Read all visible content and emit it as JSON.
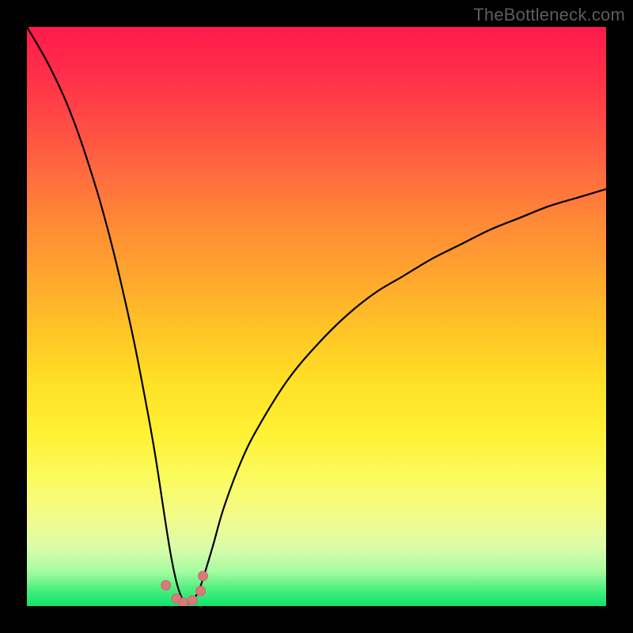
{
  "watermark": "TheBottleneck.com",
  "colors": {
    "frame_border": "#000000",
    "curve_stroke": "#000000",
    "marker_fill": "#d87a7a",
    "marker_stroke": "#c96a6a",
    "gradient_top": "#ff1a4b",
    "gradient_bottom": "#0ce36e"
  },
  "chart_data": {
    "type": "line",
    "title": "",
    "xlabel": "",
    "ylabel": "",
    "xlim": [
      0,
      100
    ],
    "ylim": [
      0,
      100
    ],
    "grid": false,
    "legend": false,
    "description": "Bottleneck-percentage style curve: value starts near 100% at x≈0, falls steeply to ≈0% at the optimum near x≈27, then rises again toward ≈70% at x=100. Y-axis inverted visually (low value = bottom = green).",
    "series": [
      {
        "name": "bottleneck-curve",
        "x": [
          0,
          4,
          8,
          12,
          15,
          18,
          20,
          22,
          24,
          25,
          26,
          27,
          28,
          29,
          30,
          32,
          34,
          37,
          40,
          45,
          50,
          55,
          60,
          65,
          70,
          75,
          80,
          85,
          90,
          95,
          100
        ],
        "values": [
          100,
          93,
          84,
          72,
          61,
          48,
          38,
          27,
          14,
          8,
          3.5,
          1,
          0.5,
          1.5,
          3.5,
          10,
          17,
          25,
          31,
          39,
          45,
          50,
          54,
          57,
          60,
          62.5,
          65,
          67,
          69,
          70.5,
          72
        ]
      }
    ],
    "markers": {
      "name": "optimum-markers",
      "x": [
        24.0,
        25.8,
        27.0,
        28.6,
        30.0,
        30.4
      ],
      "values": [
        3.6,
        1.3,
        0.6,
        1.0,
        2.6,
        5.2
      ],
      "radius": [
        6,
        6,
        6,
        6,
        6,
        6
      ]
    }
  }
}
